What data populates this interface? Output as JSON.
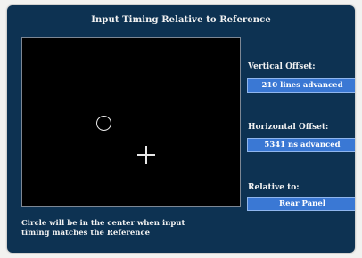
{
  "window": {
    "title": "Input Timing Relative to Reference"
  },
  "display": {
    "circle_icon": "offset-indicator-circle",
    "crosshair_icon": "center-crosshair"
  },
  "vertical_offset": {
    "label": "Vertical Offset:",
    "value": "210 lines advanced"
  },
  "horizontal_offset": {
    "label": "Horizontal Offset:",
    "value": "5341 ns advanced"
  },
  "relative_to": {
    "label": "Relative to:",
    "value": "Rear Panel"
  },
  "caption": {
    "line1": "Circle will be in the center when input",
    "line2": "timing matches the Reference"
  },
  "colors": {
    "panel_bg": "#0d3252",
    "value_box": "#3a78d4",
    "display_bg": "#000000"
  }
}
